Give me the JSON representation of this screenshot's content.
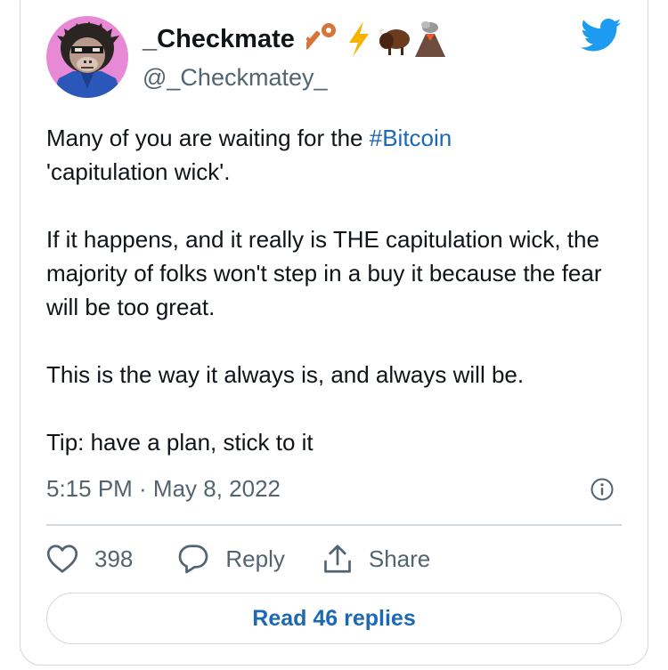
{
  "tweet": {
    "display_name": "_Checkmate",
    "name_emojis": [
      "key-emoji",
      "lightning-emoji",
      "bison-emoji",
      "volcano-emoji"
    ],
    "handle": "@_Checkmatey_",
    "text_parts": {
      "line1_prefix": "Many of you are waiting for the ",
      "hashtag": "#Bitcoin",
      "line1_suffix": "'capitulation wick'.",
      "paragraph2": "If it happens, and it really is THE capitulation wick, the majority of folks won't step in a buy it because the fear will be too great.",
      "paragraph3": "This is the way it always is, and always will be.",
      "paragraph4": "Tip: have a plan, stick to it"
    },
    "timestamp": "5:15 PM · May 8, 2022"
  },
  "actions": {
    "like_count": "398",
    "reply_label": "Reply",
    "share_label": "Share"
  },
  "footer": {
    "read_replies_label": "Read 46 replies"
  },
  "colors": {
    "link": "#1d68b5",
    "twitter_blue": "#1d9bf0",
    "muted": "#536471",
    "border": "#cfd9de",
    "avatar_bg": "#e889d6"
  },
  "icons": {
    "brand": "twitter-bird-icon",
    "info": "info-icon",
    "like": "heart-icon",
    "reply": "speech-bubble-icon",
    "share": "share-upload-icon"
  }
}
